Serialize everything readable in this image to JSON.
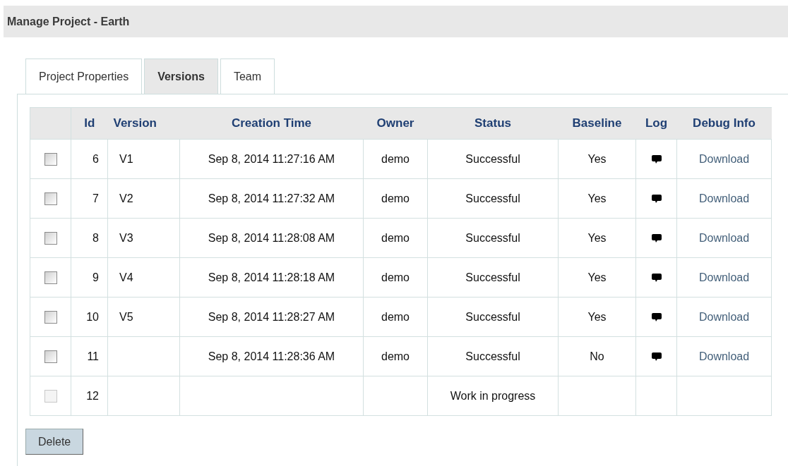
{
  "page_title": "Manage Project - Earth",
  "tabs": [
    {
      "label": "Project Properties",
      "selected": false
    },
    {
      "label": "Versions",
      "selected": true
    },
    {
      "label": "Team",
      "selected": false
    }
  ],
  "table": {
    "columns": [
      "Id",
      "Version",
      "Creation Time",
      "Owner",
      "Status",
      "Baseline",
      "Log",
      "Debug Info"
    ],
    "rows": [
      {
        "checked": false,
        "disabled": false,
        "id": "6",
        "version": "V1",
        "creation_time": "Sep 8, 2014 11:27:16 AM",
        "owner": "demo",
        "status": "Successful",
        "baseline": "Yes",
        "log": true,
        "debug_info": "Download"
      },
      {
        "checked": false,
        "disabled": false,
        "id": "7",
        "version": "V2",
        "creation_time": "Sep 8, 2014 11:27:32 AM",
        "owner": "demo",
        "status": "Successful",
        "baseline": "Yes",
        "log": true,
        "debug_info": "Download"
      },
      {
        "checked": false,
        "disabled": false,
        "id": "8",
        "version": "V3",
        "creation_time": "Sep 8, 2014 11:28:08 AM",
        "owner": "demo",
        "status": "Successful",
        "baseline": "Yes",
        "log": true,
        "debug_info": "Download"
      },
      {
        "checked": false,
        "disabled": false,
        "id": "9",
        "version": "V4",
        "creation_time": "Sep 8, 2014 11:28:18 AM",
        "owner": "demo",
        "status": "Successful",
        "baseline": "Yes",
        "log": true,
        "debug_info": "Download"
      },
      {
        "checked": false,
        "disabled": false,
        "id": "10",
        "version": "V5",
        "creation_time": "Sep 8, 2014 11:28:27 AM",
        "owner": "demo",
        "status": "Successful",
        "baseline": "Yes",
        "log": true,
        "debug_info": "Download"
      },
      {
        "checked": false,
        "disabled": false,
        "id": "11",
        "creation_time": "Sep 8, 2014 11:28:36 AM",
        "owner": "demo",
        "status": "Successful",
        "baseline": "No",
        "log": true,
        "debug_info": "Download"
      },
      {
        "checked": false,
        "disabled": true,
        "id": "12",
        "status": "Work in progress",
        "log": false
      }
    ]
  },
  "buttons": [
    "Delete"
  ]
}
